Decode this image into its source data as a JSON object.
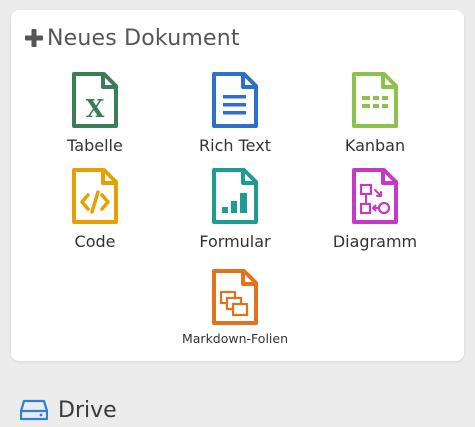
{
  "new_document": {
    "title": "Neues Dokument",
    "plus_icon": "plus-icon"
  },
  "doc_types": [
    {
      "label": "Tabelle",
      "icon": "spreadsheet-file-icon",
      "color": "#3a7d56"
    },
    {
      "label": "Rich Text",
      "icon": "richtext-file-icon",
      "color": "#2e6fc9"
    },
    {
      "label": "Kanban",
      "icon": "kanban-file-icon",
      "color": "#8bc34a"
    },
    {
      "label": "Code",
      "icon": "code-file-icon",
      "color": "#e6a100"
    },
    {
      "label": "Formular",
      "icon": "form-file-icon",
      "color": "#1e9c94"
    },
    {
      "label": "Diagramm",
      "icon": "diagram-file-icon",
      "color": "#c639c6"
    },
    {
      "label": "Markdown-Folien",
      "icon": "slides-file-icon",
      "color": "#e0731c"
    }
  ],
  "drive": {
    "label": "Drive",
    "icon": "drive-icon",
    "color": "#2e7ed6"
  }
}
